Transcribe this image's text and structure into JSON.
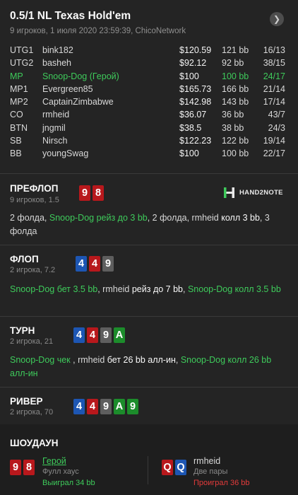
{
  "header": {
    "title": "0.5/1 NL Texas Hold'em",
    "subtitle": "9 игроков, 1 июля 2020 23:59:39, ChicoNetwork",
    "nav_icon": "chevron-right-icon"
  },
  "players": [
    {
      "pos": "UTG1",
      "name": "bink182",
      "stack": "$120.59",
      "bb": "121 bb",
      "stat": "16/13"
    },
    {
      "pos": "UTG2",
      "name": "basheh",
      "stack": "$92.12",
      "bb": "92 bb",
      "stat": "38/15"
    },
    {
      "pos": "MP",
      "name": "Snoop-Dog (Герой)",
      "stack": "$100",
      "bb": "100 bb",
      "stat": "24/17"
    },
    {
      "pos": "MP1",
      "name": "Evergreen85",
      "stack": "$165.73",
      "bb": "166 bb",
      "stat": "21/14"
    },
    {
      "pos": "MP2",
      "name": "CaptainZimbabwe",
      "stack": "$142.98",
      "bb": "143 bb",
      "stat": "17/14"
    },
    {
      "pos": "CO",
      "name": "rmheid",
      "stack": "$36.07",
      "bb": "36 bb",
      "stat": "43/7"
    },
    {
      "pos": "BTN",
      "name": "jngmil",
      "stack": "$38.5",
      "bb": "38 bb",
      "stat": "24/3"
    },
    {
      "pos": "SB",
      "name": "Nirsch",
      "stack": "$122.23",
      "bb": "122 bb",
      "stat": "19/14"
    },
    {
      "pos": "BB",
      "name": "youngSwag",
      "stack": "$100",
      "bb": "100 bb",
      "stat": "22/17"
    }
  ],
  "colors": {
    "hero": "#3ecb5b",
    "hearts": "#b8181c",
    "diamonds": "#1d56b3",
    "clubs": "#1c8c2b",
    "spades": "#5e5e5e",
    "loss": "#e33b3b"
  },
  "preflop": {
    "title": "ПРЕФЛОП",
    "sub": "9 игроков, 1.5",
    "cards": [
      {
        "rank": "9",
        "suit": "h"
      },
      {
        "rank": "8",
        "suit": "h"
      }
    ],
    "logo": "HAND2NOTE",
    "action": {
      "p1": "2 фолда, ",
      "hero_act": "Snoop-Dog рейз до 3 bb",
      "p2": ", 2 фолда, rmheid ",
      "villain_act": "колл 3 bb",
      "p3": ", 3 фолда"
    }
  },
  "flop": {
    "title": "ФЛОП",
    "sub": "2 игрока, 7.2",
    "cards": [
      {
        "rank": "4",
        "suit": "d"
      },
      {
        "rank": "4",
        "suit": "h"
      },
      {
        "rank": "9",
        "suit": "s"
      }
    ],
    "action": {
      "hero_act1": "Snoop-Dog бет 3.5 bb",
      "p1": ", rmheid ",
      "villain_act": "рейз до 7 bb",
      "p2": ", ",
      "hero_act2": "Snoop-Dog колл 3.5 bb"
    }
  },
  "turn": {
    "title": "ТУРН",
    "sub": "2 игрока, 21",
    "cards": [
      {
        "rank": "4",
        "suit": "d"
      },
      {
        "rank": "4",
        "suit": "h"
      },
      {
        "rank": "9",
        "suit": "s"
      },
      {
        "rank": "A",
        "suit": "c"
      }
    ],
    "action": {
      "hero_act1": "Snoop-Dog чек ",
      "p1": ", rmheid ",
      "villain_act": "бет 26 bb алл-ин",
      "p2": ", ",
      "hero_act2": "Snoop-Dog колл 26 bb алл-ин"
    }
  },
  "river": {
    "title": "РИВЕР",
    "sub": "2 игрока, 70",
    "cards": [
      {
        "rank": "4",
        "suit": "d"
      },
      {
        "rank": "4",
        "suit": "h"
      },
      {
        "rank": "9",
        "suit": "s"
      },
      {
        "rank": "A",
        "suit": "c"
      },
      {
        "rank": "9",
        "suit": "c"
      }
    ]
  },
  "showdown": {
    "title": "ШОУДАУН",
    "hero": {
      "name": "Герой",
      "hand": "Фулл хаус",
      "result": "Выиграл 34 bb",
      "cards": [
        {
          "rank": "9",
          "suit": "h"
        },
        {
          "rank": "8",
          "suit": "h"
        }
      ]
    },
    "villain": {
      "name": "rmheid",
      "hand": "Две пары",
      "result": "Проиграл 36 bb",
      "cards": [
        {
          "rank": "Q",
          "suit": "h"
        },
        {
          "rank": "Q",
          "suit": "d"
        }
      ]
    }
  }
}
